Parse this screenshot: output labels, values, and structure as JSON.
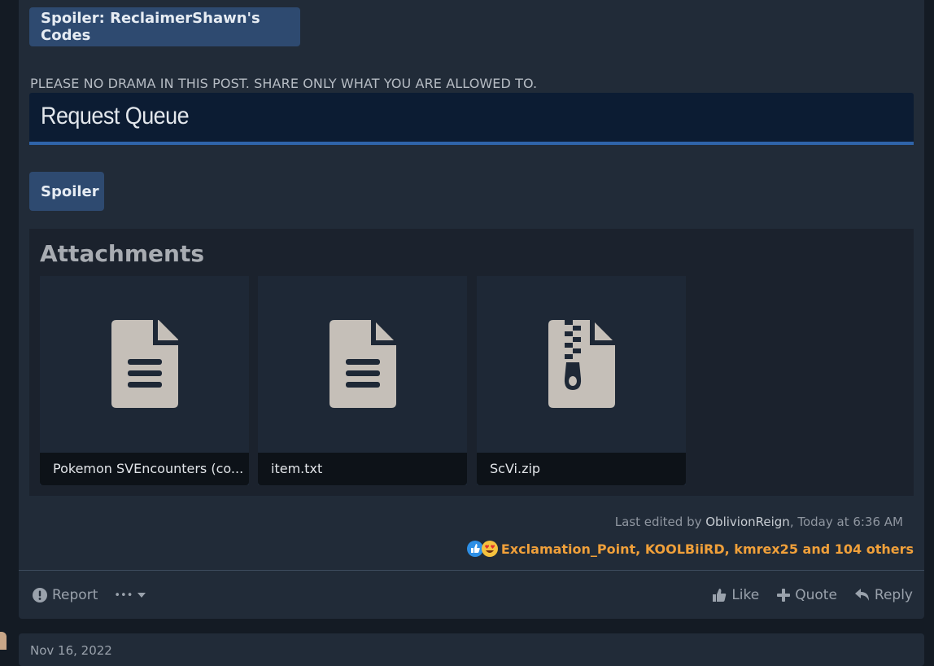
{
  "post": {
    "spoiler_codes_label": "Spoiler: ReclaimerShawn's Codes",
    "notice": "PLEASE NO DRAMA IN THIS POST. SHARE ONLY WHAT YOU ARE ALLOWED TO.",
    "section_heading": "Request Queue",
    "spoiler_label": "Spoiler"
  },
  "attachments": {
    "title": "Attachments",
    "items": [
      {
        "name": "Pokemon SVEncounters (co...",
        "icon": "document-icon"
      },
      {
        "name": "item.txt",
        "icon": "document-icon"
      },
      {
        "name": "ScVi.zip",
        "icon": "zip-file-icon"
      }
    ]
  },
  "edit_info": {
    "prefix": "Last edited by ",
    "user": "OblivionReign",
    "time": ", Today at 6:36 AM"
  },
  "reactions": {
    "summary": "Exclamation_Point, KOOLBiiRD, kmrex25 and 104 others",
    "icons": [
      "like-reaction-icon",
      "love-reaction-icon"
    ]
  },
  "footer": {
    "report": "Report",
    "more": "•••",
    "like": "Like",
    "quote": "Quote",
    "reply": "Reply"
  },
  "next_post": {
    "date": "Nov 16, 2022"
  },
  "colors": {
    "accent_orange": "#f0a03a",
    "spoiler_button": "#2e4a70",
    "heading_bar": "#0c1c33",
    "heading_underline": "#2f64aa"
  }
}
